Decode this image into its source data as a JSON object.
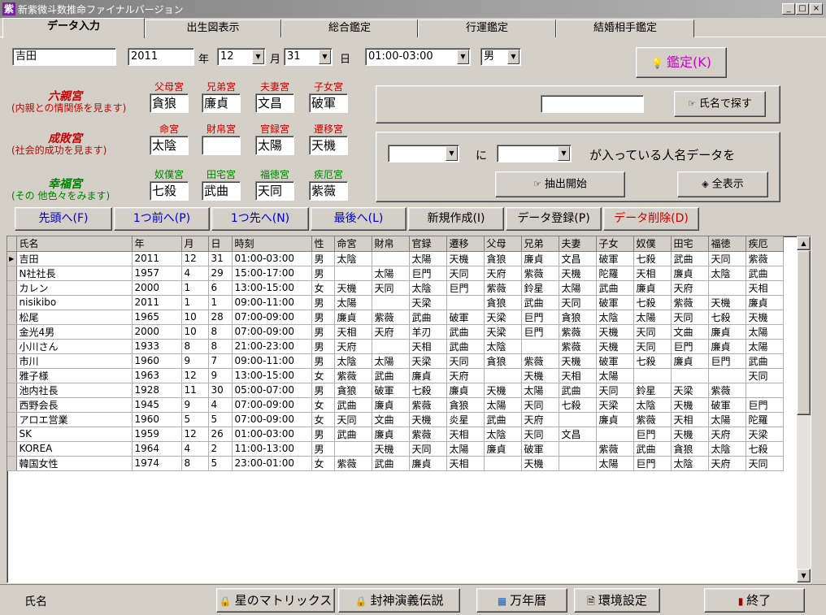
{
  "window": {
    "title": "新紫微斗数推命ファイナルバージョン",
    "app_icon": "紫"
  },
  "tabs": [
    "データ入力",
    "出生図表示",
    "総合鑑定",
    "行運鑑定",
    "結婚相手鑑定"
  ],
  "form": {
    "name": "吉田",
    "year": "2011",
    "year_unit": "年",
    "month": "12",
    "month_unit": "月",
    "day": "31",
    "day_unit": "日",
    "time": "01:00-03:00",
    "sex": "男",
    "judge_label": "鑑定(K)"
  },
  "groups": [
    {
      "title": "六親宮",
      "desc": "(内親との情関係を見ます)",
      "color": "#cc0000",
      "palaces": [
        {
          "label": "父母宮",
          "value": "貪狼"
        },
        {
          "label": "兄弟宮",
          "value": "廉貞"
        },
        {
          "label": "夫妻宮",
          "value": "文昌"
        },
        {
          "label": "子女宮",
          "value": "破軍"
        }
      ]
    },
    {
      "title": "成敗宮",
      "desc": "(社会的成功を見ます)",
      "color": "#cc0000",
      "palaces": [
        {
          "label": "命宮",
          "value": "太陰"
        },
        {
          "label": "財帛宮",
          "value": ""
        },
        {
          "label": "官録宮",
          "value": "太陽"
        },
        {
          "label": "遷移宮",
          "value": "天機"
        }
      ]
    },
    {
      "title": "幸福宮",
      "desc": "(その 他色々をみます)",
      "color": "#008000",
      "palaces": [
        {
          "label": "奴僕宮",
          "value": "七殺"
        },
        {
          "label": "田宅宮",
          "value": "武曲"
        },
        {
          "label": "福徳宮",
          "value": "天同"
        },
        {
          "label": "疾厄宮",
          "value": "紫薇"
        }
      ]
    }
  ],
  "search": {
    "name_value": "",
    "name_button": "氏名で探す",
    "filter_mid": "に",
    "filter_text": "が入っている人名データを",
    "extract_button": "抽出開始",
    "show_all_button": "全表示"
  },
  "nav": [
    {
      "label": "先頭へ(F)",
      "color": "#0000cc"
    },
    {
      "label": "1つ前へ(P)",
      "color": "#0000cc"
    },
    {
      "label": "1つ先へ(N)",
      "color": "#0000cc"
    },
    {
      "label": "最後へ(L)",
      "color": "#0000cc"
    },
    {
      "label": "新規作成(I)",
      "color": "#000000"
    },
    {
      "label": "データ登録(P)",
      "color": "#000000"
    },
    {
      "label": "データ削除(D)",
      "color": "#cc0000"
    }
  ],
  "table": {
    "columns": [
      "氏名",
      "年",
      "月",
      "日",
      "時刻",
      "性",
      "命宮",
      "財帛",
      "官録",
      "遷移",
      "父母",
      "兄弟",
      "夫妻",
      "子女",
      "奴僕",
      "田宅",
      "福徳",
      "疾厄"
    ],
    "rows": [
      [
        "吉田",
        "2011",
        "12",
        "31",
        "01:00-03:00",
        "男",
        "太陰",
        "",
        "太陽",
        "天機",
        "貪狼",
        "廉貞",
        "文昌",
        "破軍",
        "七殺",
        "武曲",
        "天同",
        "紫薇"
      ],
      [
        "N社社長",
        "1957",
        "4",
        "29",
        "15:00-17:00",
        "男",
        "",
        "太陽",
        "巨門",
        "天同",
        "天府",
        "紫薇",
        "天機",
        "陀羅",
        "天相",
        "廉貞",
        "太陰",
        "武曲"
      ],
      [
        "カレン",
        "2000",
        "1",
        "6",
        "13:00-15:00",
        "女",
        "天機",
        "天同",
        "太陰",
        "巨門",
        "紫薇",
        "鈴星",
        "太陽",
        "武曲",
        "廉貞",
        "天府",
        "",
        "天相"
      ],
      [
        "nisikibo",
        "2011",
        "1",
        "1",
        "09:00-11:00",
        "男",
        "太陽",
        "",
        "天梁",
        "",
        "貪狼",
        "武曲",
        "天同",
        "破軍",
        "七殺",
        "紫薇",
        "天機",
        "廉貞"
      ],
      [
        "松尾",
        "1965",
        "10",
        "28",
        "07:00-09:00",
        "男",
        "廉貞",
        "紫薇",
        "武曲",
        "破軍",
        "天梁",
        "巨門",
        "貪狼",
        "太陰",
        "太陽",
        "天同",
        "七殺",
        "天機"
      ],
      [
        "金光4男",
        "2000",
        "10",
        "8",
        "07:00-09:00",
        "男",
        "天相",
        "天府",
        "羊刃",
        "武曲",
        "天梁",
        "巨門",
        "紫薇",
        "天機",
        "天同",
        "文曲",
        "廉貞",
        "太陽"
      ],
      [
        "小川さん",
        "1933",
        "8",
        "8",
        "21:00-23:00",
        "男",
        "天府",
        "",
        "天相",
        "武曲",
        "太陰",
        "",
        "紫薇",
        "天機",
        "天同",
        "巨門",
        "廉貞",
        "太陽"
      ],
      [
        "市川",
        "1960",
        "9",
        "7",
        "09:00-11:00",
        "男",
        "太陰",
        "太陽",
        "天梁",
        "天同",
        "貪狼",
        "紫薇",
        "天機",
        "破軍",
        "七殺",
        "廉貞",
        "巨門",
        "武曲"
      ],
      [
        "雅子様",
        "1963",
        "12",
        "9",
        "13:00-15:00",
        "女",
        "紫薇",
        "武曲",
        "廉貞",
        "天府",
        "",
        "天機",
        "天相",
        "太陽",
        "",
        "",
        "",
        "天同"
      ],
      [
        "池内社長",
        "1928",
        "11",
        "30",
        "05:00-07:00",
        "男",
        "貪狼",
        "破軍",
        "七殺",
        "廉貞",
        "天機",
        "太陽",
        "武曲",
        "天同",
        "鈴星",
        "天梁",
        "紫薇",
        ""
      ],
      [
        "西野会長",
        "1945",
        "9",
        "4",
        "07:00-09:00",
        "女",
        "武曲",
        "廉貞",
        "紫薇",
        "貪狼",
        "太陽",
        "天同",
        "七殺",
        "天梁",
        "太陰",
        "天機",
        "破軍",
        "巨門"
      ],
      [
        "アロエ営業",
        "1960",
        "5",
        "5",
        "07:00-09:00",
        "女",
        "天同",
        "文曲",
        "天機",
        "炎星",
        "武曲",
        "天府",
        "",
        "廉貞",
        "紫薇",
        "天相",
        "太陽",
        "陀羅"
      ],
      [
        "SK",
        "1959",
        "12",
        "26",
        "01:00-03:00",
        "男",
        "武曲",
        "廉貞",
        "紫薇",
        "天相",
        "太陰",
        "天同",
        "文昌",
        "",
        "巨門",
        "天機",
        "天府",
        "天梁"
      ],
      [
        "KOREA",
        "1964",
        "4",
        "2",
        "11:00-13:00",
        "男",
        "",
        "天機",
        "天同",
        "太陽",
        "廉貞",
        "破軍",
        "",
        "紫薇",
        "武曲",
        "貪狼",
        "太陰",
        "七殺"
      ],
      [
        "韓国女性",
        "1974",
        "8",
        "5",
        "23:00-01:00",
        "女",
        "紫薇",
        "武曲",
        "廉貞",
        "天相",
        "",
        "天機",
        "",
        "太陽",
        "巨門",
        "太陰",
        "天府",
        "天同"
      ]
    ]
  },
  "status": {
    "label": "氏名"
  },
  "bottom_buttons": [
    "星のマトリックス",
    "封神演義伝説",
    "万年暦",
    "環境設定",
    "終了"
  ]
}
